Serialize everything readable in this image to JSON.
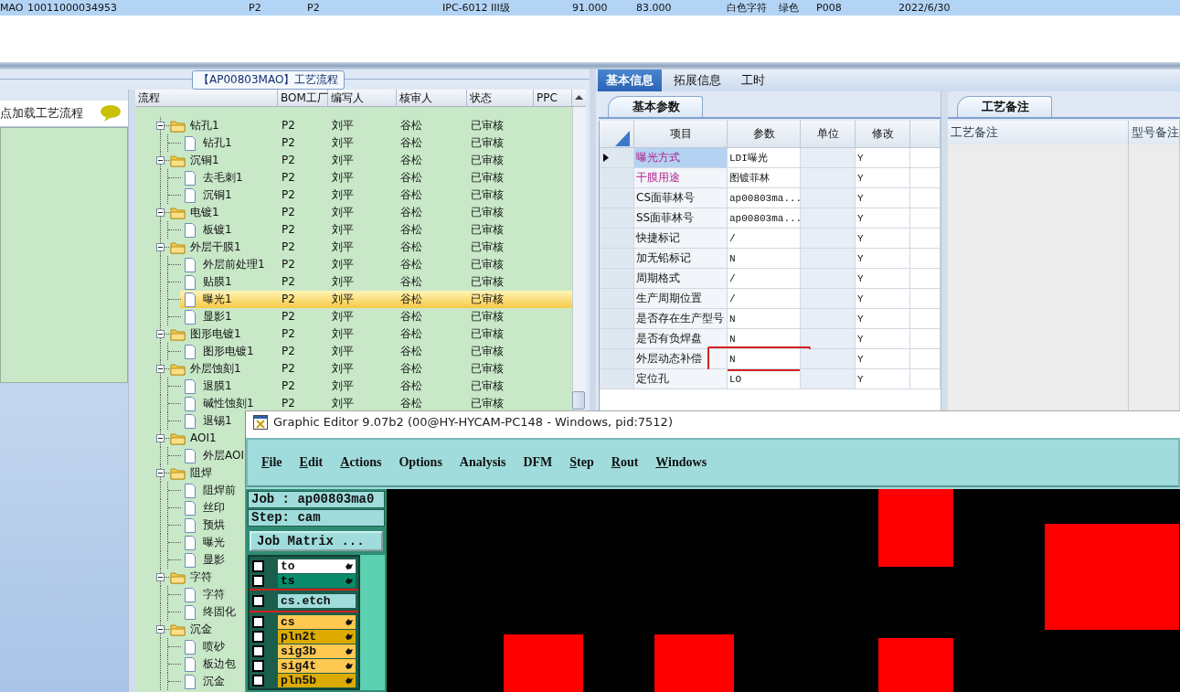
{
  "record_row": {
    "selected": true,
    "cells": [
      "MAO",
      "10011000034953",
      "P2",
      "P2",
      "IPC-6012 III级",
      "91.000",
      "83.000",
      "白色字符",
      "绿色",
      "P008",
      "2022/6/30"
    ]
  },
  "flow_panel": {
    "title": "【AP00803MAO】工艺流程",
    "sidebar": {
      "items": [
        {
          "label": "点加载工艺流程"
        }
      ]
    },
    "columns": [
      "流程",
      "BOM工厂",
      "编写人",
      "核审人",
      "状态",
      "PPC"
    ],
    "tree": [
      {
        "name": "钻孔1",
        "kind": "folder",
        "expanded": true,
        "selected": false,
        "cells": [
          "P2",
          "刘平",
          "谷松",
          "已审核"
        ],
        "children": [
          {
            "name": "钻孔1",
            "kind": "file",
            "selected": false,
            "cells": [
              "P2",
              "刘平",
              "谷松",
              "已审核"
            ]
          }
        ]
      },
      {
        "name": "沉铜1",
        "kind": "folder",
        "expanded": true,
        "selected": false,
        "cells": [
          "P2",
          "刘平",
          "谷松",
          "已审核"
        ],
        "children": [
          {
            "name": "去毛刺1",
            "kind": "file",
            "selected": false,
            "cells": [
              "P2",
              "刘平",
              "谷松",
              "已审核"
            ]
          },
          {
            "name": "沉铜1",
            "kind": "file",
            "selected": false,
            "cells": [
              "P2",
              "刘平",
              "谷松",
              "已审核"
            ]
          }
        ]
      },
      {
        "name": "电镀1",
        "kind": "folder",
        "expanded": true,
        "selected": false,
        "cells": [
          "P2",
          "刘平",
          "谷松",
          "已审核"
        ],
        "children": [
          {
            "name": "板镀1",
            "kind": "file",
            "selected": false,
            "cells": [
              "P2",
              "刘平",
              "谷松",
              "已审核"
            ]
          }
        ]
      },
      {
        "name": "外层干膜1",
        "kind": "folder",
        "expanded": true,
        "selected": false,
        "cells": [
          "P2",
          "刘平",
          "谷松",
          "已审核"
        ],
        "children": [
          {
            "name": "外层前处理1",
            "kind": "file",
            "selected": false,
            "cells": [
              "P2",
              "刘平",
              "谷松",
              "已审核"
            ]
          },
          {
            "name": "贴膜1",
            "kind": "file",
            "selected": false,
            "cells": [
              "P2",
              "刘平",
              "谷松",
              "已审核"
            ]
          },
          {
            "name": "曝光1",
            "kind": "file",
            "selected": true,
            "cells": [
              "P2",
              "刘平",
              "谷松",
              "已审核"
            ]
          },
          {
            "name": "显影1",
            "kind": "file",
            "selected": false,
            "cells": [
              "P2",
              "刘平",
              "谷松",
              "已审核"
            ]
          }
        ]
      },
      {
        "name": "图形电镀1",
        "kind": "folder",
        "expanded": true,
        "selected": false,
        "cells": [
          "P2",
          "刘平",
          "谷松",
          "已审核"
        ],
        "children": [
          {
            "name": "图形电镀1",
            "kind": "file",
            "selected": false,
            "cells": [
              "P2",
              "刘平",
              "谷松",
              "已审核"
            ]
          }
        ]
      },
      {
        "name": "外层蚀刻1",
        "kind": "folder",
        "expanded": true,
        "selected": false,
        "cells": [
          "P2",
          "刘平",
          "谷松",
          "已审核"
        ],
        "children": [
          {
            "name": "退膜1",
            "kind": "file",
            "selected": false,
            "cells": [
              "P2",
              "刘平",
              "谷松",
              "已审核"
            ]
          },
          {
            "name": "碱性蚀刻1",
            "kind": "file",
            "selected": false,
            "cells": [
              "P2",
              "刘平",
              "谷松",
              "已审核"
            ]
          },
          {
            "name": "退锡1",
            "kind": "file",
            "selected": false
          }
        ]
      },
      {
        "name": "AOI1",
        "kind": "folder",
        "expanded": true,
        "selected": false,
        "children": [
          {
            "name": "外层AOI",
            "kind": "file",
            "selected": false
          }
        ]
      },
      {
        "name": "阻焊",
        "kind": "folder",
        "expanded": true,
        "selected": false,
        "children": [
          {
            "name": "阻焊前",
            "kind": "file",
            "selected": false
          },
          {
            "name": "丝印",
            "kind": "file",
            "selected": false
          },
          {
            "name": "预烘",
            "kind": "file",
            "selected": false
          },
          {
            "name": "曝光",
            "kind": "file",
            "selected": false
          },
          {
            "name": "显影",
            "kind": "file",
            "selected": false
          }
        ]
      },
      {
        "name": "字符",
        "kind": "folder",
        "expanded": true,
        "selected": false,
        "children": [
          {
            "name": "字符",
            "kind": "file",
            "selected": false
          },
          {
            "name": "终固化",
            "kind": "file",
            "selected": false
          }
        ]
      },
      {
        "name": "沉金",
        "kind": "folder",
        "expanded": true,
        "selected": false,
        "children": [
          {
            "name": "喷砂",
            "kind": "file",
            "selected": false
          },
          {
            "name": "板边包",
            "kind": "file",
            "selected": false
          },
          {
            "name": "沉金",
            "kind": "file",
            "selected": false
          }
        ]
      }
    ]
  },
  "info_tabs": [
    {
      "label": "基本信息",
      "selected": true
    },
    {
      "label": "拓展信息",
      "selected": false
    },
    {
      "label": "工时",
      "selected": false
    }
  ],
  "params": {
    "tab": "基本参数",
    "columns": [
      "项目",
      "参数",
      "单位",
      "修改"
    ],
    "rows": [
      {
        "item": "曝光方式",
        "value": "LDI曝光",
        "modify": "Y",
        "current": true,
        "emphasized": true,
        "highlighted": false
      },
      {
        "item": "干膜用途",
        "value": "图镀菲林",
        "modify": "Y",
        "current": false,
        "emphasized": true,
        "highlighted": false
      },
      {
        "item": "CS面菲林号",
        "value": "ap00803ma...",
        "modify": "Y",
        "current": false,
        "emphasized": false,
        "highlighted": false
      },
      {
        "item": "SS面菲林号",
        "value": "ap00803ma...",
        "modify": "Y",
        "current": false,
        "emphasized": false,
        "highlighted": false
      },
      {
        "item": "快捷标记",
        "value": "/",
        "modify": "Y",
        "current": false,
        "emphasized": false,
        "highlighted": false
      },
      {
        "item": "加无铅标记",
        "value": "N",
        "modify": "Y",
        "current": false,
        "emphasized": false,
        "highlighted": false
      },
      {
        "item": "周期格式",
        "value": "/",
        "modify": "Y",
        "current": false,
        "emphasized": false,
        "highlighted": false
      },
      {
        "item": "生产周期位置",
        "value": "/",
        "modify": "Y",
        "current": false,
        "emphasized": false,
        "highlighted": false
      },
      {
        "item": "是否存在生产型号",
        "value": "N",
        "modify": "Y",
        "current": false,
        "emphasized": false,
        "highlighted": false
      },
      {
        "item": "是否有负焊盘",
        "value": "N",
        "modify": "Y",
        "current": false,
        "emphasized": false,
        "highlighted": false
      },
      {
        "item": "外层动态补偿",
        "value": "N",
        "modify": "Y",
        "current": false,
        "emphasized": false,
        "highlighted": true
      },
      {
        "item": "定位孔",
        "value": "LO",
        "modify": "Y",
        "current": false,
        "emphasized": false,
        "highlighted": false
      }
    ]
  },
  "notes": {
    "tab": "工艺备注",
    "columns": [
      "工艺备注",
      "型号备注"
    ]
  },
  "editor": {
    "title": "Graphic Editor 9.07b2 (00@HY-HYCAM-PC148 - Windows, pid:7512)",
    "menus": [
      {
        "label": "File",
        "mnemonic": true
      },
      {
        "label": "Edit",
        "mnemonic": true
      },
      {
        "label": "Actions",
        "mnemonic": true
      },
      {
        "label": "Options",
        "mnemonic": false
      },
      {
        "label": "Analysis",
        "mnemonic": false
      },
      {
        "label": "DFM",
        "mnemonic": false
      },
      {
        "label": "Step",
        "mnemonic": true
      },
      {
        "label": "Rout",
        "mnemonic": true
      },
      {
        "label": "Windows",
        "mnemonic": true
      }
    ],
    "job": "Job : ap00803ma0",
    "step": "Step: cam",
    "matrix_button": "Job Matrix ...",
    "layers": [
      {
        "name": "to",
        "color": "#ffffff",
        "pointer": true,
        "highlighted": false,
        "checked": false
      },
      {
        "name": "ts",
        "color": "#0a8c6c",
        "pointer": true,
        "highlighted": false,
        "checked": false
      },
      {
        "name": "cs.etch",
        "color": "#a0dcdc",
        "pointer": false,
        "highlighted": true,
        "checked": false
      },
      {
        "name": "cs",
        "color": "#ffc850",
        "pointer": true,
        "highlighted": false,
        "checked": false
      },
      {
        "name": "pln2t",
        "color": "#dcaa00",
        "pointer": true,
        "highlighted": false,
        "checked": false
      },
      {
        "name": "sig3b",
        "color": "#ffc850",
        "pointer": true,
        "highlighted": false,
        "checked": false
      },
      {
        "name": "sig4t",
        "color": "#ffc850",
        "pointer": true,
        "highlighted": false,
        "checked": false
      },
      {
        "name": "pln5b",
        "color": "#dcaa00",
        "pointer": true,
        "highlighted": false,
        "checked": false
      }
    ]
  }
}
